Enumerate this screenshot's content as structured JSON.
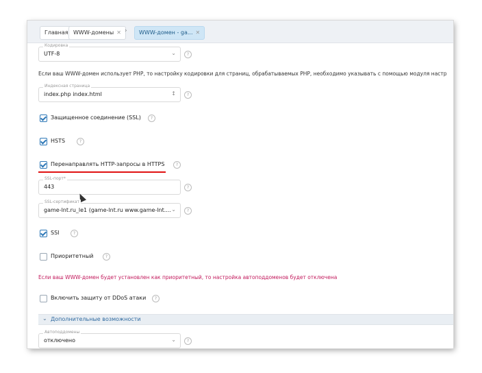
{
  "breadcrumbs": {
    "home": "Главная",
    "www_domains": "WWW-домены",
    "current": "WWW-домен - ga..."
  },
  "encoding": {
    "label": "Кодировка",
    "value": "UTF-8",
    "note": "Если ваш WWW-домен использует PHP, то настройку кодировки для страниц, обрабатываемых PHP, необходимо указывать с помощью модуля настр"
  },
  "index_page": {
    "label": "Индексная страница",
    "value": "index.php index.html"
  },
  "checkboxes": {
    "ssl": "Защищенное соединение (SSL)",
    "hsts": "HSTS",
    "redirect_https": "Перенаправлять HTTP-запросы в HTTPS",
    "ssi": "SSI",
    "priority": "Приоритетный",
    "ddos": "Включить защиту от DDoS атаки"
  },
  "ssl_port": {
    "label": "SSL-порт*",
    "value": "443"
  },
  "ssl_cert": {
    "label": "SSL-сертификат",
    "value": "game-lnt.ru_le1 (game-lnt.ru www.game-lnt...."
  },
  "priority_note": "Если ваш WWW-домен будет установлен как приоритетный, то настройка автоподдоменов будет отключена",
  "section": {
    "title": "Дополнительные возможности"
  },
  "autosubdomains": {
    "label": "Автоподдомены",
    "value": "отключено"
  },
  "help_glyph": "?",
  "colors": {
    "accent": "#2e78b7",
    "warning_text": "#c2185b",
    "annotation": "#e01010"
  }
}
